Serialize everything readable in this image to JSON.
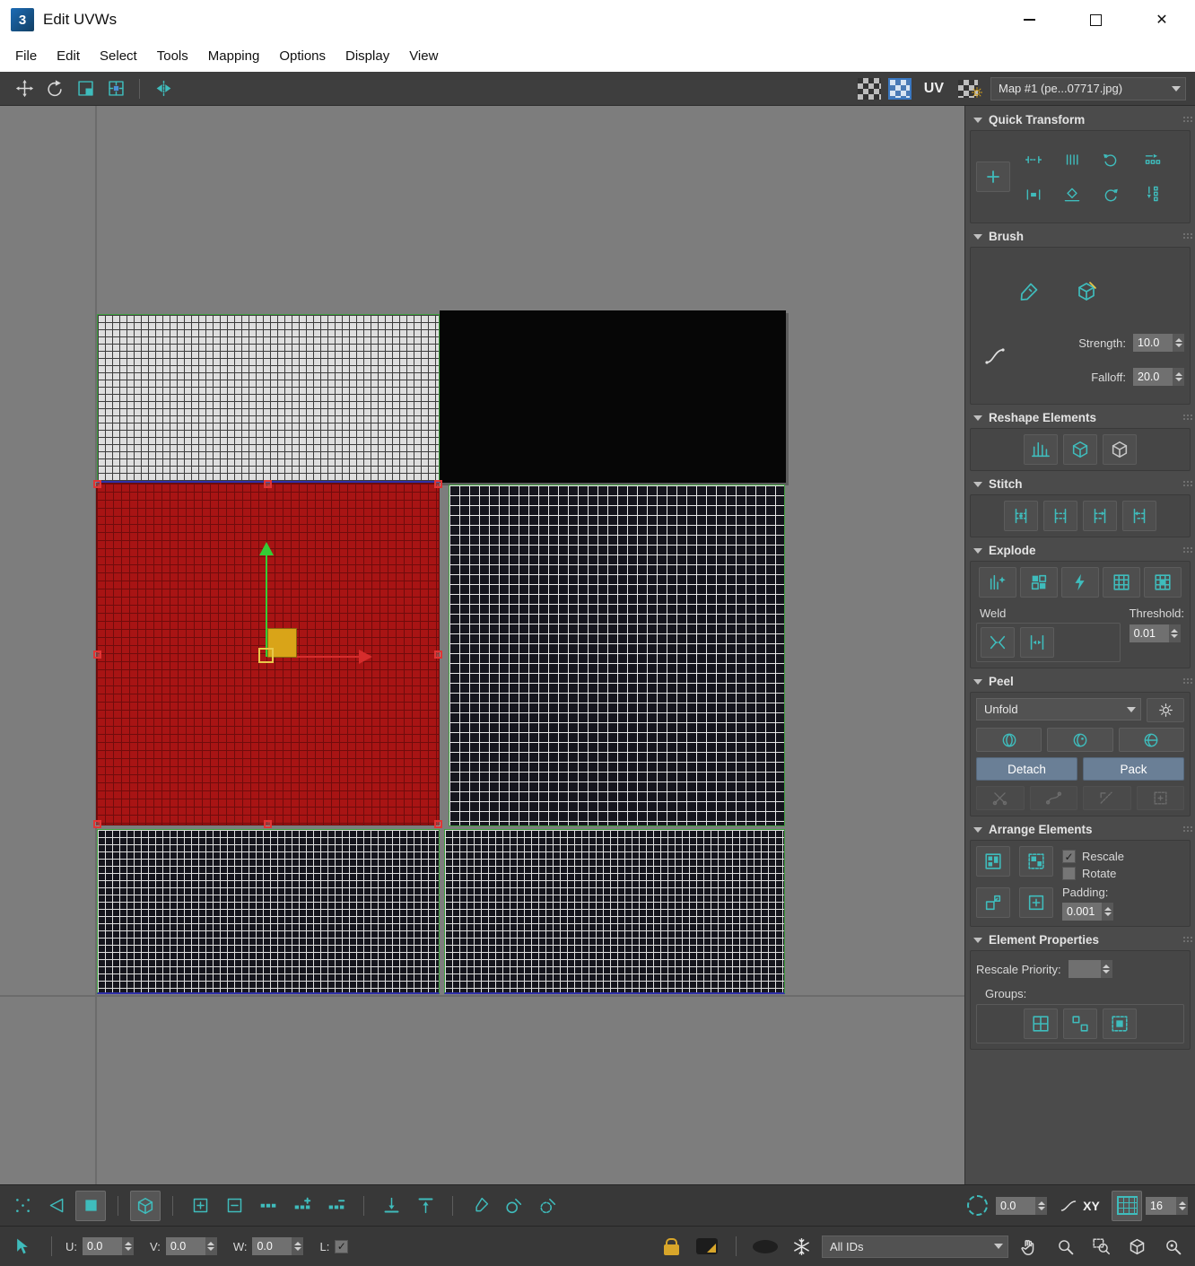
{
  "window": {
    "title": "Edit UVWs",
    "close_glyph": "✕"
  },
  "glyphs": {
    "check": "✓"
  },
  "menubar": {
    "items": [
      "File",
      "Edit",
      "Select",
      "Tools",
      "Mapping",
      "Options",
      "Display",
      "View"
    ]
  },
  "toolbar": {
    "uv_label": "UV",
    "map_select": "Map #1 (pe...07717.jpg)"
  },
  "rollouts": {
    "quick_transform": {
      "title": "Quick Transform"
    },
    "brush": {
      "title": "Brush",
      "strength_label": "Strength:",
      "strength_value": "10.0",
      "falloff_label": "Falloff:",
      "falloff_value": "20.0"
    },
    "reshape": {
      "title": "Reshape Elements"
    },
    "stitch": {
      "title": "Stitch"
    },
    "explode": {
      "title": "Explode",
      "weld_label": "Weld",
      "threshold_label": "Threshold:",
      "threshold_value": "0.01"
    },
    "peel": {
      "title": "Peel",
      "mode_value": "Unfold",
      "detach_label": "Detach",
      "pack_label": "Pack"
    },
    "arrange": {
      "title": "Arrange Elements",
      "rescale_label": "Rescale",
      "rotate_label": "Rotate",
      "padding_label": "Padding:",
      "padding_value": "0.001"
    },
    "element_properties": {
      "title": "Element Properties",
      "rescale_priority_label": "Rescale Priority:",
      "rescale_priority_value": "",
      "groups_label": "Groups:"
    }
  },
  "bottom_toolbar": {
    "angle_value": "0.0",
    "xy_label": "XY",
    "grid_value": "16"
  },
  "statusbar": {
    "u_label": "U:",
    "u_value": "0.0",
    "v_label": "V:",
    "v_value": "0.0",
    "w_label": "W:",
    "w_value": "0.0",
    "l_label": "L:",
    "ids_value": "All IDs"
  }
}
